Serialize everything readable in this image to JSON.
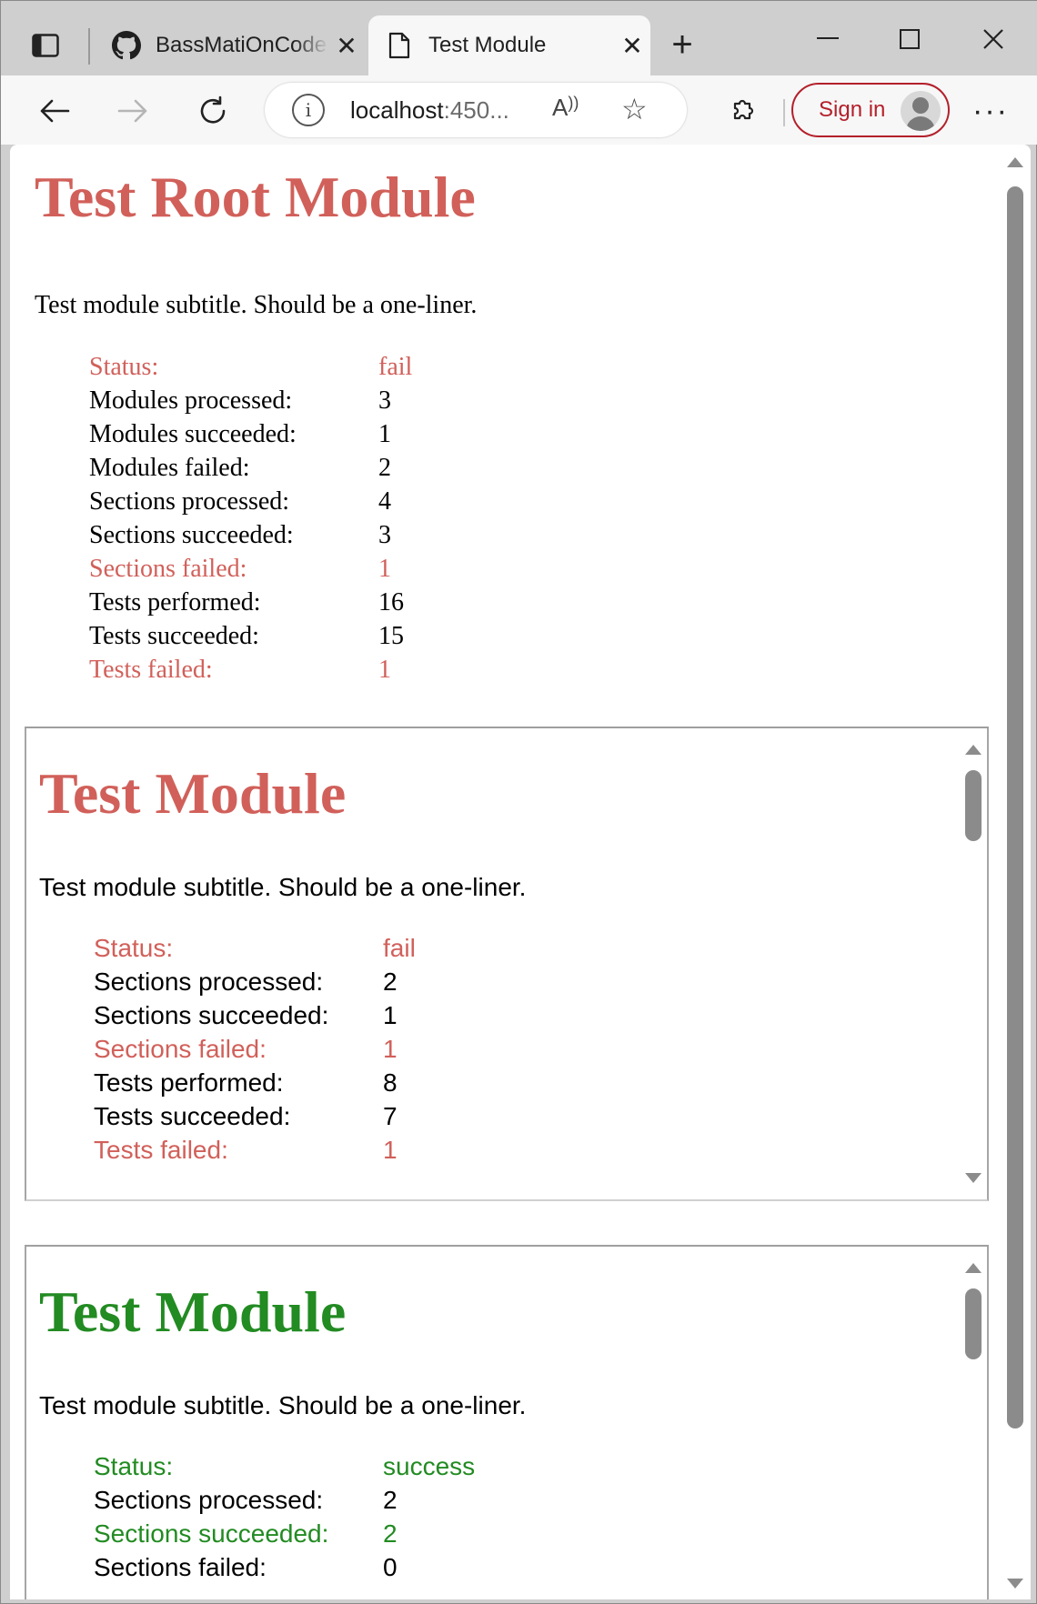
{
  "browser": {
    "tabs": [
      {
        "title": "BassMatiOnCode",
        "icon": "github-icon"
      },
      {
        "title": "Test Module",
        "icon": "page-icon"
      }
    ],
    "address": {
      "host": "localhost",
      "rest": ":450..."
    },
    "sign_in_label": "Sign in",
    "colors": {
      "accent": "#b3202b",
      "tabstrip": "#cfcfcf",
      "toolbar": "#f7f7f7"
    }
  },
  "root": {
    "title": "Test Root Module",
    "subtitle": "Test module subtitle. Should be a one-liner.",
    "status": "fail",
    "stats": [
      {
        "label": "Status:",
        "value": "fail",
        "highlight": "fail"
      },
      {
        "label": "Modules processed:",
        "value": "3",
        "highlight": ""
      },
      {
        "label": "Modules succeeded:",
        "value": "1",
        "highlight": ""
      },
      {
        "label": "Modules failed:",
        "value": "2",
        "highlight": ""
      },
      {
        "label": "Sections processed:",
        "value": "4",
        "highlight": ""
      },
      {
        "label": "Sections succeeded:",
        "value": "3",
        "highlight": ""
      },
      {
        "label": "Sections failed:",
        "value": "1",
        "highlight": "fail"
      },
      {
        "label": "Tests performed:",
        "value": "16",
        "highlight": ""
      },
      {
        "label": "Tests succeeded:",
        "value": "15",
        "highlight": ""
      },
      {
        "label": "Tests failed:",
        "value": "1",
        "highlight": "fail"
      }
    ]
  },
  "modules": [
    {
      "title": "Test Module",
      "subtitle": "Test module subtitle. Should be a one-liner.",
      "status": "fail",
      "stats": [
        {
          "label": "Status:",
          "value": "fail",
          "highlight": "fail"
        },
        {
          "label": "Sections processed:",
          "value": "2",
          "highlight": ""
        },
        {
          "label": "Sections succeeded:",
          "value": "1",
          "highlight": ""
        },
        {
          "label": "Sections failed:",
          "value": "1",
          "highlight": "fail"
        },
        {
          "label": "Tests performed:",
          "value": "8",
          "highlight": ""
        },
        {
          "label": "Tests succeeded:",
          "value": "7",
          "highlight": ""
        },
        {
          "label": "Tests failed:",
          "value": "1",
          "highlight": "fail"
        }
      ]
    },
    {
      "title": "Test Module",
      "subtitle": "Test module subtitle. Should be a one-liner.",
      "status": "success",
      "stats": [
        {
          "label": "Status:",
          "value": "success",
          "highlight": "ok"
        },
        {
          "label": "Sections processed:",
          "value": "2",
          "highlight": ""
        },
        {
          "label": "Sections succeeded:",
          "value": "2",
          "highlight": "ok"
        },
        {
          "label": "Sections failed:",
          "value": "0",
          "highlight": ""
        }
      ]
    }
  ],
  "colors": {
    "fail": "#d1605a",
    "success": "#228b22"
  }
}
